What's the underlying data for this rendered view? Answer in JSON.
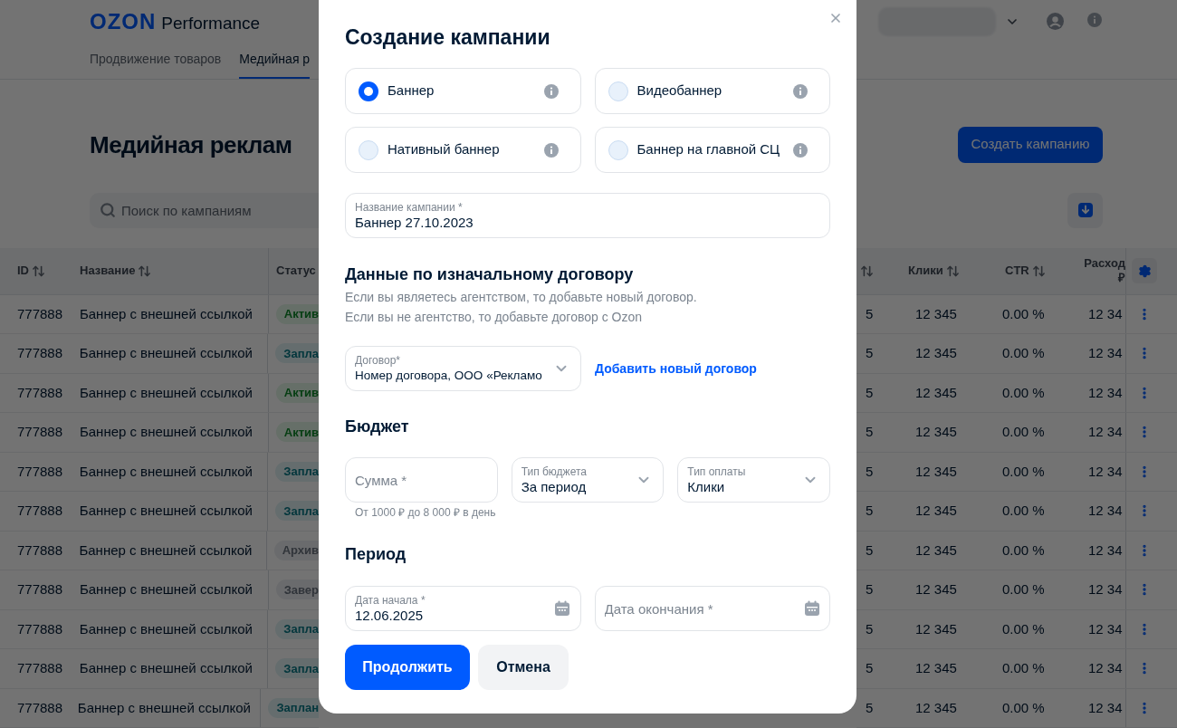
{
  "header": {
    "logo": {
      "brand": "OZON",
      "product": "Performance"
    },
    "nav": [
      {
        "label": "Продвижение товаров",
        "selected": false
      },
      {
        "label": "Медийная р",
        "selected": true
      }
    ]
  },
  "page": {
    "title": "Медийная реклам",
    "create_button": "Создать кампанию",
    "search": {
      "placeholder": "Поиск по кампаниям"
    }
  },
  "table": {
    "columns_left": [
      {
        "label": "ID",
        "sortable": true
      },
      {
        "label": "Название",
        "sortable": true
      },
      {
        "label": "Статус",
        "sortable": false
      }
    ],
    "columns_right": [
      {
        "sortable": true
      },
      {
        "label": "Клики",
        "sortable": true
      },
      {
        "label": "CTR",
        "sortable": true
      },
      {
        "label": "Расход ₽",
        "sortable": false
      }
    ],
    "rows": [
      {
        "id": "777888",
        "name": "Баннер с внешней ссылкой",
        "status": {
          "label": "Актив",
          "kind": "active"
        },
        "column_1": "5",
        "clicks": "12 345",
        "ctr": "0.00 %",
        "spend": "12 34"
      },
      {
        "id": "777888",
        "name": "Баннер с внешней ссылкой",
        "status": {
          "label": "Запла",
          "kind": "planned"
        },
        "column_1": "5",
        "clicks": "12 345",
        "ctr": "0.00 %",
        "spend": "12 34"
      },
      {
        "id": "777888",
        "name": "Баннер с внешней ссылкой",
        "status": {
          "label": "Актив",
          "kind": "active"
        },
        "column_1": "5",
        "clicks": "12 345",
        "ctr": "0.00 %",
        "spend": "12 34"
      },
      {
        "id": "777888",
        "name": "Баннер с внешней ссылкой",
        "status": {
          "label": "Актив",
          "kind": "active"
        },
        "column_1": "5",
        "clicks": "12 345",
        "ctr": "0.00 %",
        "spend": "12 34"
      },
      {
        "id": "777888",
        "name": "Баннер с внешней ссылкой",
        "status": {
          "label": "Запла",
          "kind": "planned"
        },
        "column_1": "5",
        "clicks": "12 345",
        "ctr": "0.00 %",
        "spend": "12 34"
      },
      {
        "id": "777888",
        "name": "Баннер с внешней ссылкой",
        "status": {
          "label": "Запла",
          "kind": "planned"
        },
        "column_1": "5",
        "clicks": "12 345",
        "ctr": "0.00 %",
        "spend": "12 34"
      },
      {
        "id": "777888",
        "name": "Баннер с внешней ссылкой",
        "status": {
          "label": "Архив",
          "kind": "archived"
        },
        "column_1": "5",
        "clicks": "12 345",
        "ctr": "0.00 %",
        "spend": "12 34"
      },
      {
        "id": "777888",
        "name": "Баннер с внешней ссылкой",
        "status": {
          "label": "Завер",
          "kind": "finished"
        },
        "column_1": "5",
        "clicks": "12 345",
        "ctr": "0.00 %",
        "spend": "12 34"
      },
      {
        "id": "777888",
        "name": "Баннер с внешней ссылкой",
        "status": {
          "label": "Запла",
          "kind": "planned"
        },
        "column_1": "5",
        "clicks": "12 345",
        "ctr": "0.00 %",
        "spend": "12 34"
      },
      {
        "id": "777888",
        "name": "Баннер с внешней ссылкой",
        "status": {
          "label": "Запла",
          "kind": "planned"
        },
        "column_1": "5",
        "clicks": "12 345",
        "ctr": "0.00 %",
        "spend": "12 34"
      },
      {
        "id": "777888",
        "name": "Баннер с внешней ссылкой",
        "status": {
          "label": "Заплан",
          "kind": "planned"
        },
        "column_1": "5",
        "clicks": "12 345",
        "ctr": "0.00 %",
        "spend": "12 34"
      }
    ]
  },
  "modal": {
    "title": "Создание кампании",
    "formats": [
      {
        "label": "Баннер",
        "selected": true
      },
      {
        "label": "Видеобаннер",
        "selected": false
      },
      {
        "label": "Нативный баннер",
        "selected": false
      },
      {
        "label": "Баннер на главной СЦ",
        "selected": false
      }
    ],
    "campaign_name": {
      "label": "Название кампании *",
      "value": "Баннер 27.10.2023"
    },
    "contract": {
      "title": "Данные по изначальному договору",
      "notes": [
        "Если вы являетесь агентством, то добавьте новый договор.",
        "Если вы не агентство, то добавьте договор с Ozon"
      ],
      "select": {
        "label": "Договор*",
        "value": "Номер договора, ООО «Рекламо"
      },
      "link": "Добавить новый договор"
    },
    "budget": {
      "title": "Бюджет",
      "fields": [
        {
          "kind": "input",
          "placeholder": "Сумма *"
        },
        {
          "kind": "select",
          "label": "Тип бюджета",
          "value": "За период"
        },
        {
          "kind": "select",
          "label": "Тип оплаты",
          "value": "Клики"
        }
      ],
      "hint": "От 1000 ₽ до 8 000 ₽ в день"
    },
    "period": {
      "title": "Период",
      "fields": [
        {
          "label": "Дата начала *",
          "value": "12.06.2025"
        },
        {
          "placeholder": "Дата окончания *"
        }
      ]
    },
    "buttons": {
      "primary": "Продолжить",
      "secondary": "Отмена"
    }
  }
}
